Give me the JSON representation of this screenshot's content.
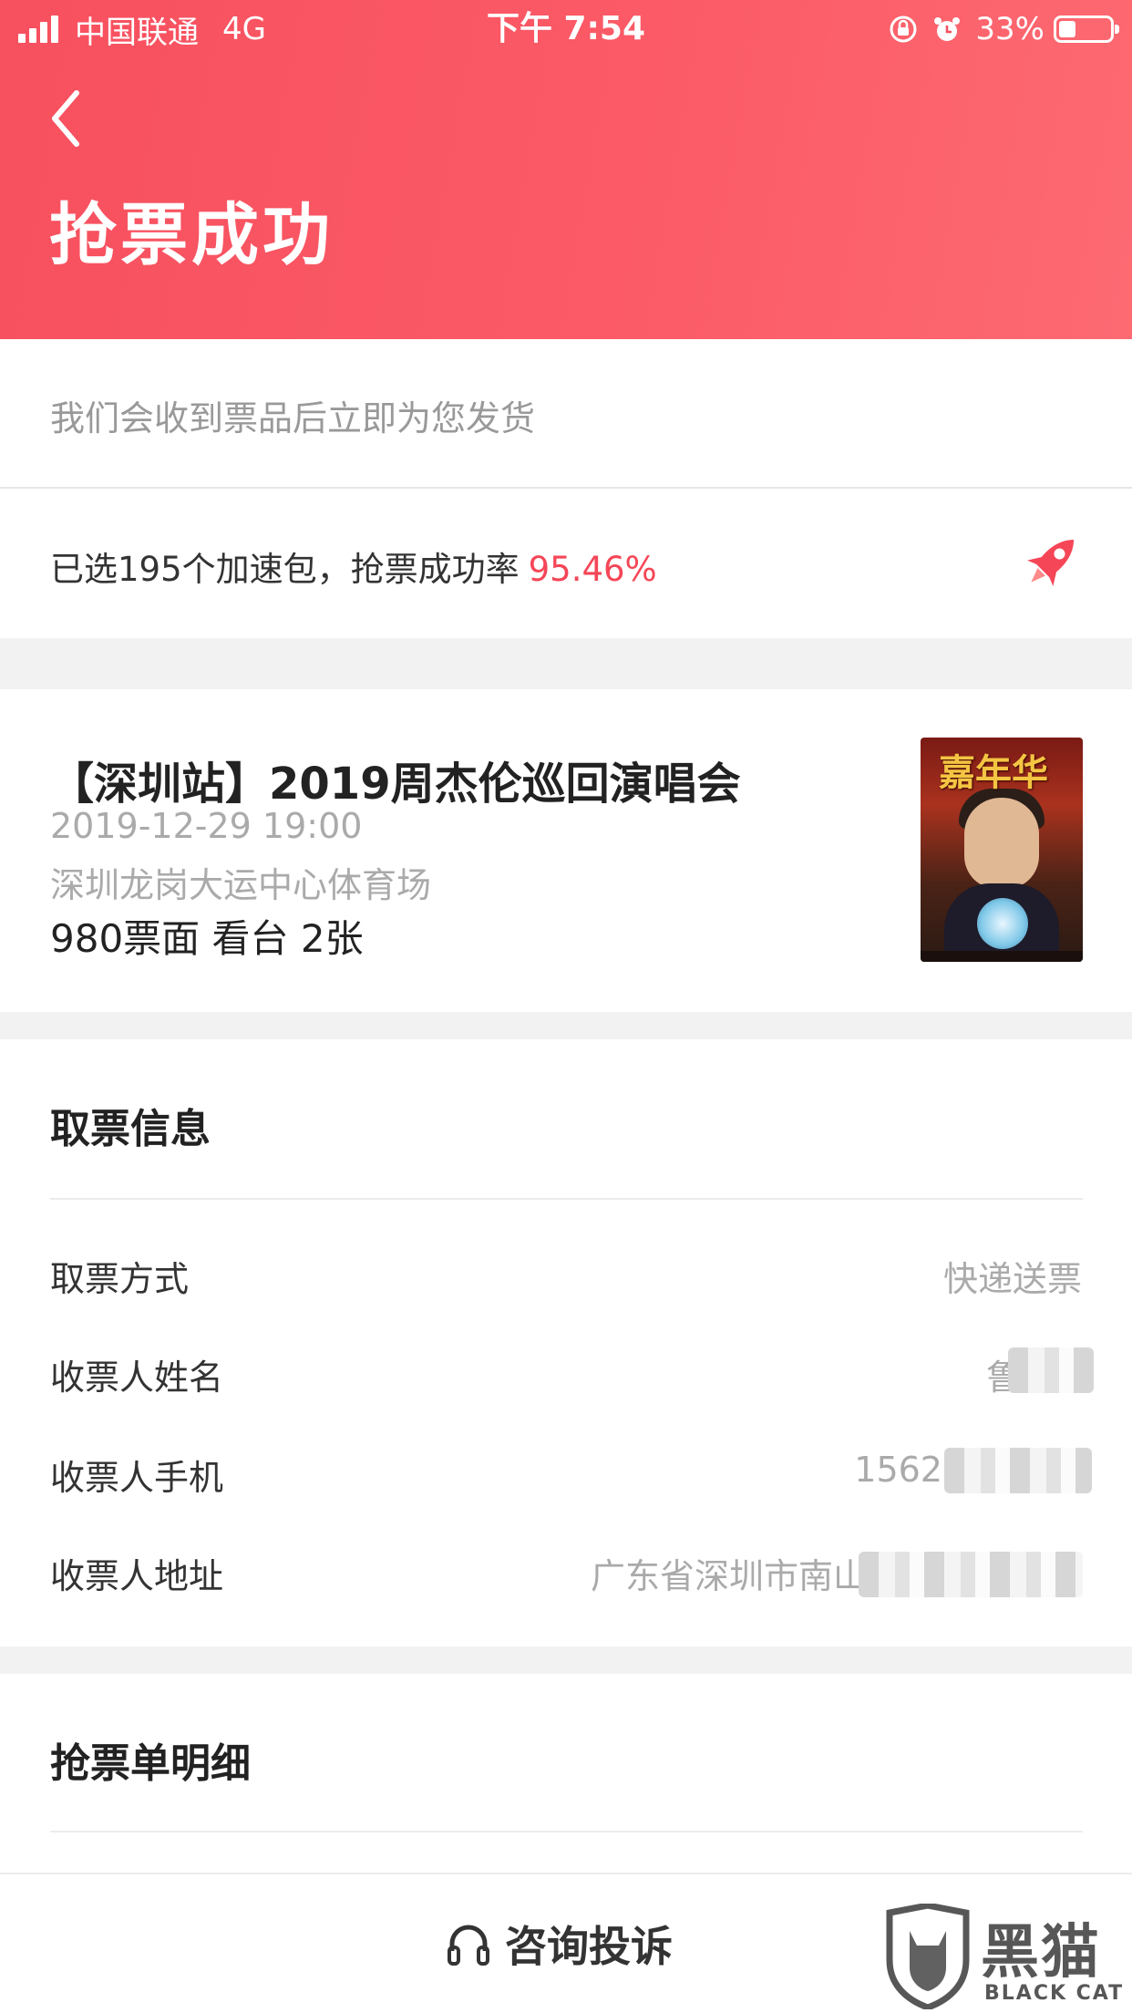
{
  "status_bar": {
    "carrier": "中国联通",
    "network": "4G",
    "time": "下午 7:54",
    "battery": "33%",
    "battery_level": 0.33
  },
  "header": {
    "title": "抢票成功",
    "back_icon": "chevron-left-icon",
    "background_color": "#f7505f"
  },
  "hint": {
    "text": "我们会收到票品后立即为您发货"
  },
  "speed": {
    "text": "已选195个加速包，抢票成功率",
    "rate": "95.46%",
    "rate_color": "#f54657",
    "icon": "rocket-icon"
  },
  "event": {
    "title": "【深圳站】2019周杰伦巡回演唱会",
    "datetime": "2019-12-29 19:00",
    "venue": "深圳龙岗大运中心体育场",
    "ticket": "980票面 看台 2张",
    "poster_title": "嘉年华"
  },
  "pickup": {
    "title": "取票信息",
    "rows": [
      {
        "label": "取票方式",
        "value": "快递送票"
      },
      {
        "label": "收票人姓名",
        "value": "鲁"
      },
      {
        "label": "收票人手机",
        "value": "1562"
      },
      {
        "label": "收票人地址",
        "value": "广东省深圳市南山"
      }
    ]
  },
  "detail": {
    "title": "抢票单明细"
  },
  "bottom": {
    "consult_label": "咨询投诉",
    "icon": "headset-icon"
  },
  "watermark": {
    "name": "黑猫",
    "sub": "BLACK CAT"
  }
}
